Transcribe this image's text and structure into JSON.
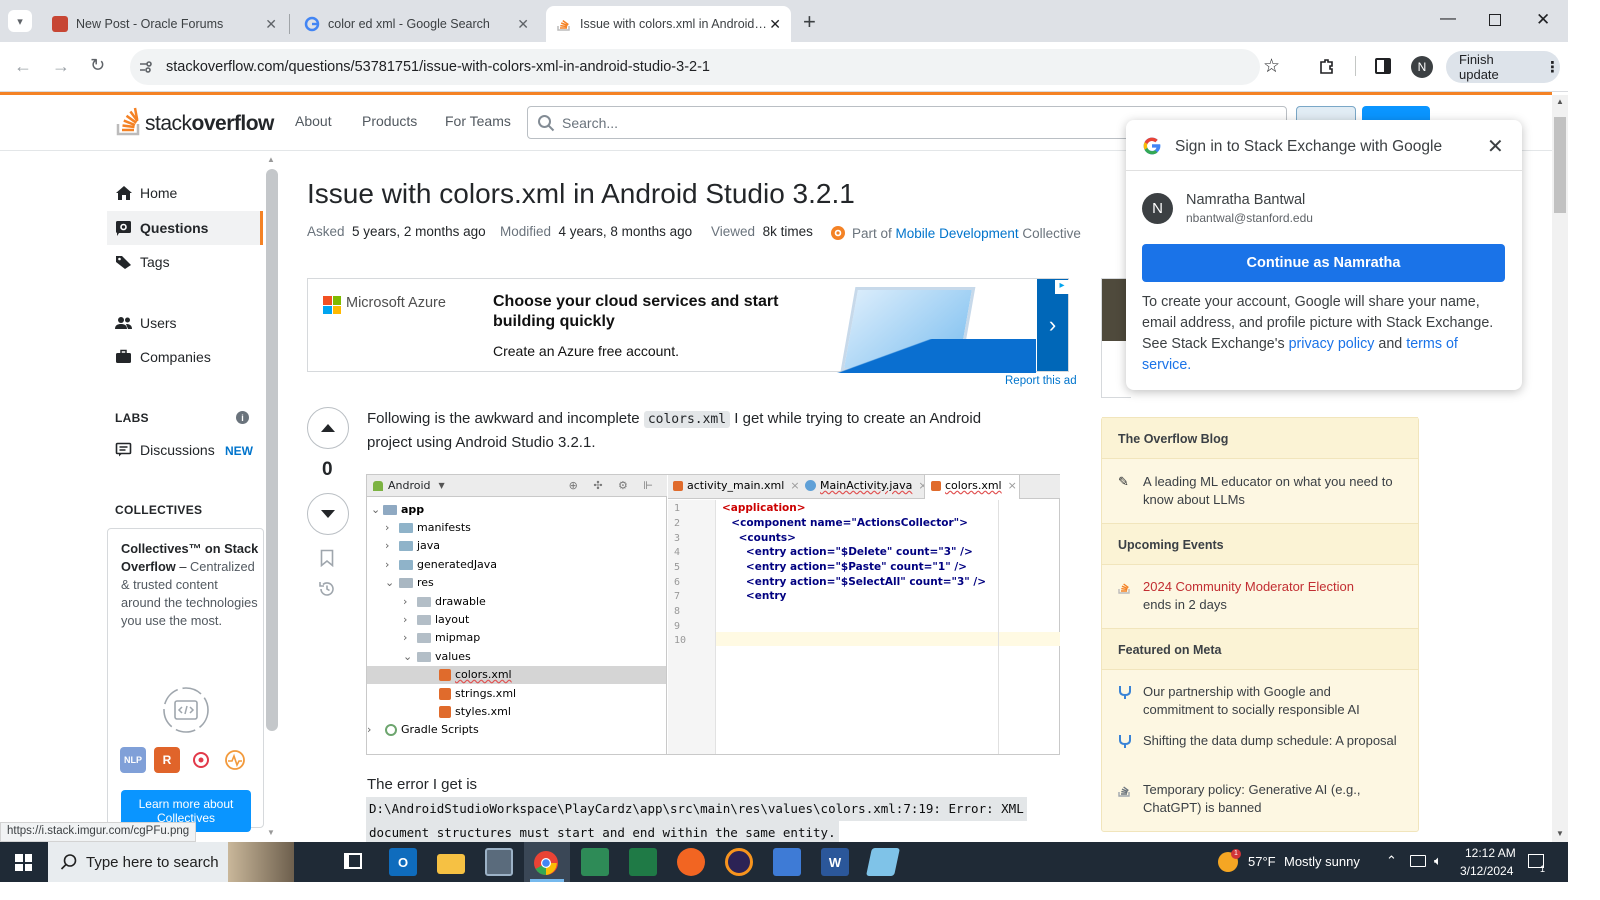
{
  "browser": {
    "tabs": [
      {
        "title": "New Post - Oracle Forums"
      },
      {
        "title": "color ed xml - Google Search"
      },
      {
        "title": "Issue with colors.xml in Android St",
        "active": true
      }
    ],
    "url": "stackoverflow.com/questions/53781751/issue-with-colors-xml-in-android-studio-3-2-1",
    "profile_initial": "N",
    "finish_update": "Finish update",
    "status_url": "https://i.stack.imgur.com/cgPFu.png"
  },
  "so_header": {
    "logo_text_plain": "stack",
    "logo_text_bold": "overflow",
    "nav": [
      "About",
      "Products",
      "For Teams"
    ],
    "search_placeholder": "Search..."
  },
  "sidebar": {
    "items": [
      "Home",
      "Questions",
      "Tags",
      "Users",
      "Companies"
    ],
    "labs_heading": "LABS",
    "discussions": "Discussions",
    "discussions_badge": "NEW",
    "collectives_heading": "COLLECTIVES",
    "collectives_title": "Collectives™ on Stack Overflow",
    "collectives_dash": " –",
    "collectives_desc": "Centralized & trusted content around the technologies you use the most.",
    "tags": [
      "NLP",
      "R"
    ],
    "learn_more": "Learn more about Collectives"
  },
  "question": {
    "title": "Issue with colors.xml in Android Studio 3.2.1",
    "asked_label": "Asked",
    "asked": "5 years, 2 months ago",
    "modified_label": "Modified",
    "modified": "4 years, 8 months ago",
    "viewed_label": "Viewed",
    "viewed": "8k times",
    "collective_prefix": "Part of",
    "collective_link": "Mobile Development",
    "collective_suffix": "Collective",
    "votes": "0",
    "body1_before": "Following is the awkward and incomplete",
    "body1_code": "colors.xml",
    "body1_after": "I get while trying to create an Android",
    "body1_line2": "project using Android Studio 3.2.1.",
    "error_intro": "The error I get is",
    "error_line1": "D:\\AndroidStudioWorkspace\\PlayCardz\\app\\src\\main\\res\\values\\colors.xml:7:19: Error: XML",
    "error_line2": "document structures must start and end within the same entity."
  },
  "ad": {
    "brand": "Microsoft Azure",
    "headline": "Choose your cloud services and start building quickly",
    "cta": "Create an Azure free account.",
    "report": "Report this ad"
  },
  "ide": {
    "project_view": "Android",
    "tabs": [
      "activity_main.xml",
      "MainActivity.java",
      "colors.xml"
    ],
    "tree": [
      "app",
      "manifests",
      "java",
      "generatedJava",
      "res",
      "drawable",
      "layout",
      "mipmap",
      "values",
      "colors.xml",
      "strings.xml",
      "styles.xml",
      "Gradle Scripts"
    ],
    "line_numbers": [
      "1",
      "2",
      "3",
      "4",
      "5",
      "6",
      "7",
      "8",
      "9",
      "10"
    ],
    "code": [
      "<application>",
      "  <component name=\"ActionsCollector\">",
      "    <counts>",
      "      <entry action=\"$Delete\" count=\"3\" />",
      "      <entry action=\"$Paste\" count=\"1\" />",
      "      <entry action=\"$SelectAll\" count=\"3\" />",
      "      <entry"
    ]
  },
  "right_rail": {
    "blog_heading": "The Overflow Blog",
    "blog_item": "A leading ML educator on what you need to know about LLMs",
    "events_heading": "Upcoming Events",
    "event_title": "2024 Community Moderator Election",
    "event_sub": "ends in 2 days",
    "meta_heading": "Featured on Meta",
    "meta_items": [
      "Our partnership with Google and commitment to socially responsible AI",
      "Shifting the data dump schedule: A proposal",
      "Temporary policy: Generative AI (e.g., ChatGPT) is banned"
    ]
  },
  "google_popup": {
    "title": "Sign in to Stack Exchange with Google",
    "avatar_initial": "N",
    "name": "Namratha Bantwal",
    "email": "nbantwal@stanford.edu",
    "continue": "Continue as Namratha",
    "desc_before": "To create your account, Google will share your name, email address, and profile picture with Stack Exchange. See Stack Exchange's",
    "privacy": "privacy policy",
    "and": "and",
    "terms": "terms of service."
  },
  "taskbar": {
    "search_placeholder": "Type here to search",
    "weather_temp": "57°F",
    "weather_desc": "Mostly sunny",
    "time": "12:12 AM",
    "date": "3/12/2024",
    "notifications": "1"
  },
  "colors": {
    "so_orange": "#f48225",
    "link_blue": "#0074cc",
    "google_blue": "#1a73e8"
  }
}
